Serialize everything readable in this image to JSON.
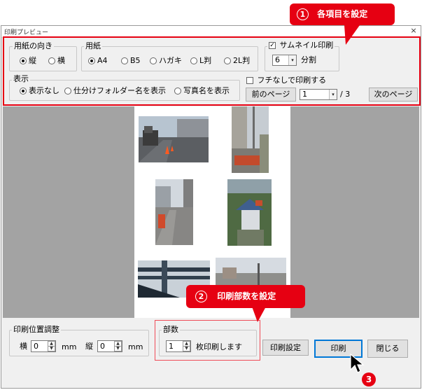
{
  "annotations": {
    "callout1_number": "1",
    "callout1_text": "各項目を設定",
    "callout2_number": "2",
    "callout2_text": "印刷部数を設定",
    "badge3_number": "3",
    "accent_color": "#e60012"
  },
  "window": {
    "title": "印刷プレビュー",
    "close_glyph": "×"
  },
  "orientation": {
    "legend": "用紙の向き",
    "options": [
      "縦",
      "横"
    ],
    "selected": "縦"
  },
  "paper": {
    "legend": "用紙",
    "options": [
      "A4",
      "B5",
      "ハガキ",
      "L判",
      "2L判"
    ],
    "selected": "A4"
  },
  "thumbnail": {
    "label": "サムネイル印刷",
    "checked": true,
    "check_glyph": "✓",
    "value": "6",
    "suffix": "分割"
  },
  "display": {
    "legend": "表示",
    "options": [
      "表示なし",
      "仕分けフォルダー名を表示",
      "写真名を表示"
    ],
    "selected": "表示なし"
  },
  "borderless": {
    "label": "フチなしで印刷する",
    "checked": false
  },
  "pager": {
    "prev_label": "前のページ",
    "page_value": "1",
    "total": "/ 3",
    "next_label": "次のページ"
  },
  "position": {
    "legend": "印刷位置調整",
    "h_label": "横",
    "h_value": "0",
    "h_unit": "mm",
    "v_label": "縦",
    "v_value": "0",
    "v_unit": "mm"
  },
  "copies": {
    "legend": "部数",
    "value": "1",
    "suffix": "枚印刷します"
  },
  "buttons": {
    "print_settings": "印刷設定",
    "print": "印刷",
    "close": "閉じる"
  },
  "icons": {
    "dropdown": "▾",
    "spin_up": "▲",
    "spin_down": "▼"
  }
}
